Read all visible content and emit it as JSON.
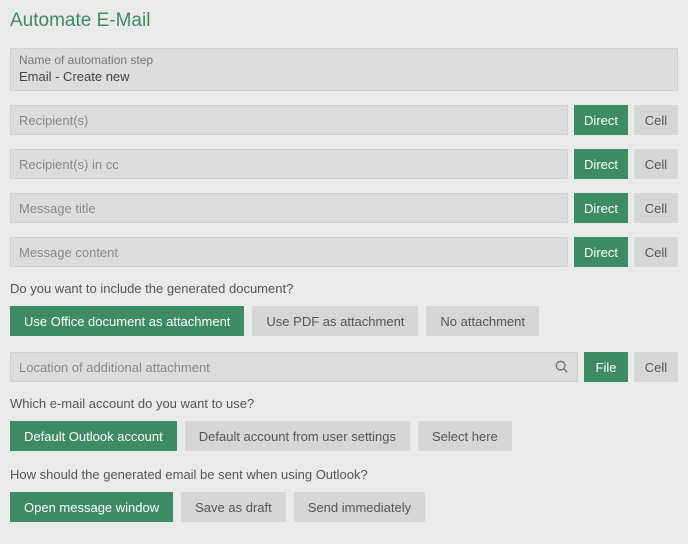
{
  "title": "Automate E-Mail",
  "nameLabel": "Name of automation step",
  "nameValue": "Email - Create new",
  "fields": {
    "recipients": "Recipient(s)",
    "cc": "Recipient(s) in cc",
    "subject": "Message title",
    "content": "Message content",
    "attachLoc": "Location of additional attachment"
  },
  "btns": {
    "direct": "Direct",
    "cell": "Cell",
    "file": "File"
  },
  "q1": "Do you want to include the generated document?",
  "opts1": {
    "office": "Use Office document as attachment",
    "pdf": "Use PDF as attachment",
    "none": "No attachment"
  },
  "q2": "Which e-mail account do you want to use?",
  "opts2": {
    "outlook": "Default Outlook account",
    "user": "Default account from user settings",
    "select": "Select here"
  },
  "q3": "How should the generated email be sent when using Outlook?",
  "opts3": {
    "open": "Open message window",
    "draft": "Save as draft",
    "send": "Send immediately"
  }
}
